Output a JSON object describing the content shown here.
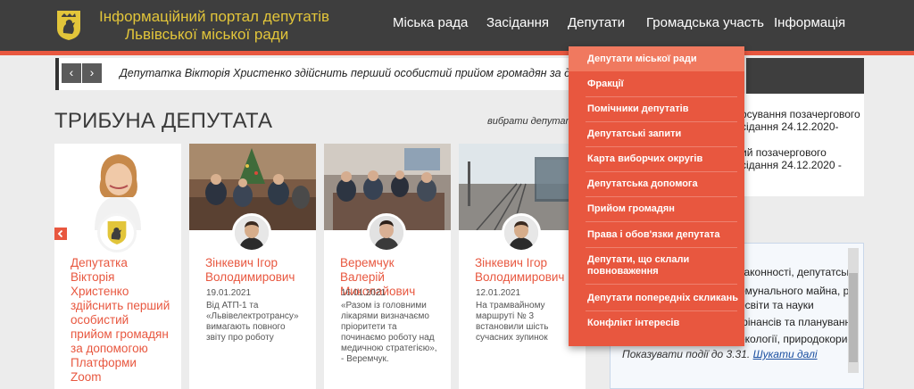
{
  "header": {
    "brand_line1": "Інформаційний портал депутатів",
    "brand_line2": "Львівської міської ради",
    "nav": [
      "Міська рада",
      "Засідання",
      "Депутати",
      "Громадська участь",
      "Інформація"
    ]
  },
  "ticker": {
    "prev_icon": "‹",
    "next_icon": "›",
    "text": "Депутатка Вікторія Христенко здійснить перший особистий прийом громадян за допом ..."
  },
  "right_panel": {
    "line1": "осування позачергового",
    "line2": "сідання 24.12.2020-",
    "line3": "ий позачергового",
    "line4": "сідання 24.12.2020 -"
  },
  "events": {
    "lines": [
      "законності, депутатськ",
      "омунального майна, р",
      "освіти та науки",
      "фінансів та планування",
      "екології, природокорис"
    ],
    "footer_prefix": "Показувати події до 3.31.",
    "footer_link": "Шукати далі"
  },
  "tribune": {
    "title": "ТРИБУНА ДЕПУТАТА",
    "choose": "вибрати депутата",
    "cards": [
      {
        "name": "Депутатка Вікторія Христенко здійснить перший особистий прийом громадян за допомогою Платформи Zoom",
        "date": "",
        "text": ""
      },
      {
        "name": "Зінкевич Ігор Володимирович",
        "date": "19.01.2021",
        "text": "Від АТП-1 та «Львівелектротрансу» вимагають повного звіту про роботу"
      },
      {
        "name": "Веремчук Валерій Миколайович",
        "date": "16.01.2021",
        "text": "«Разом із головними лікарями визначаємо пріоритети та починаємо роботу над медичною стратегією», - Веремчук."
      },
      {
        "name": "Зінкевич Ігор Володимирович",
        "date": "12.01.2021",
        "text": "На трамвайному маршруті № 3 встановили шість сучасних зупинок"
      }
    ]
  },
  "dropdown": {
    "items": [
      "Депутати міської ради",
      "Фракції",
      "Помічники депутатів",
      "Депутатські запити",
      "Карта виборчих округів",
      "Депутатська допомога",
      "Прийом громадян",
      "Права і обов'язки депутата",
      "Депутати, що склали повноваження",
      "Депутати попередніх скликань",
      "Конфлікт інтересів"
    ]
  },
  "colors": {
    "accent": "#e8573f",
    "header": "#3e3e3e",
    "brand": "#e2c53a"
  }
}
